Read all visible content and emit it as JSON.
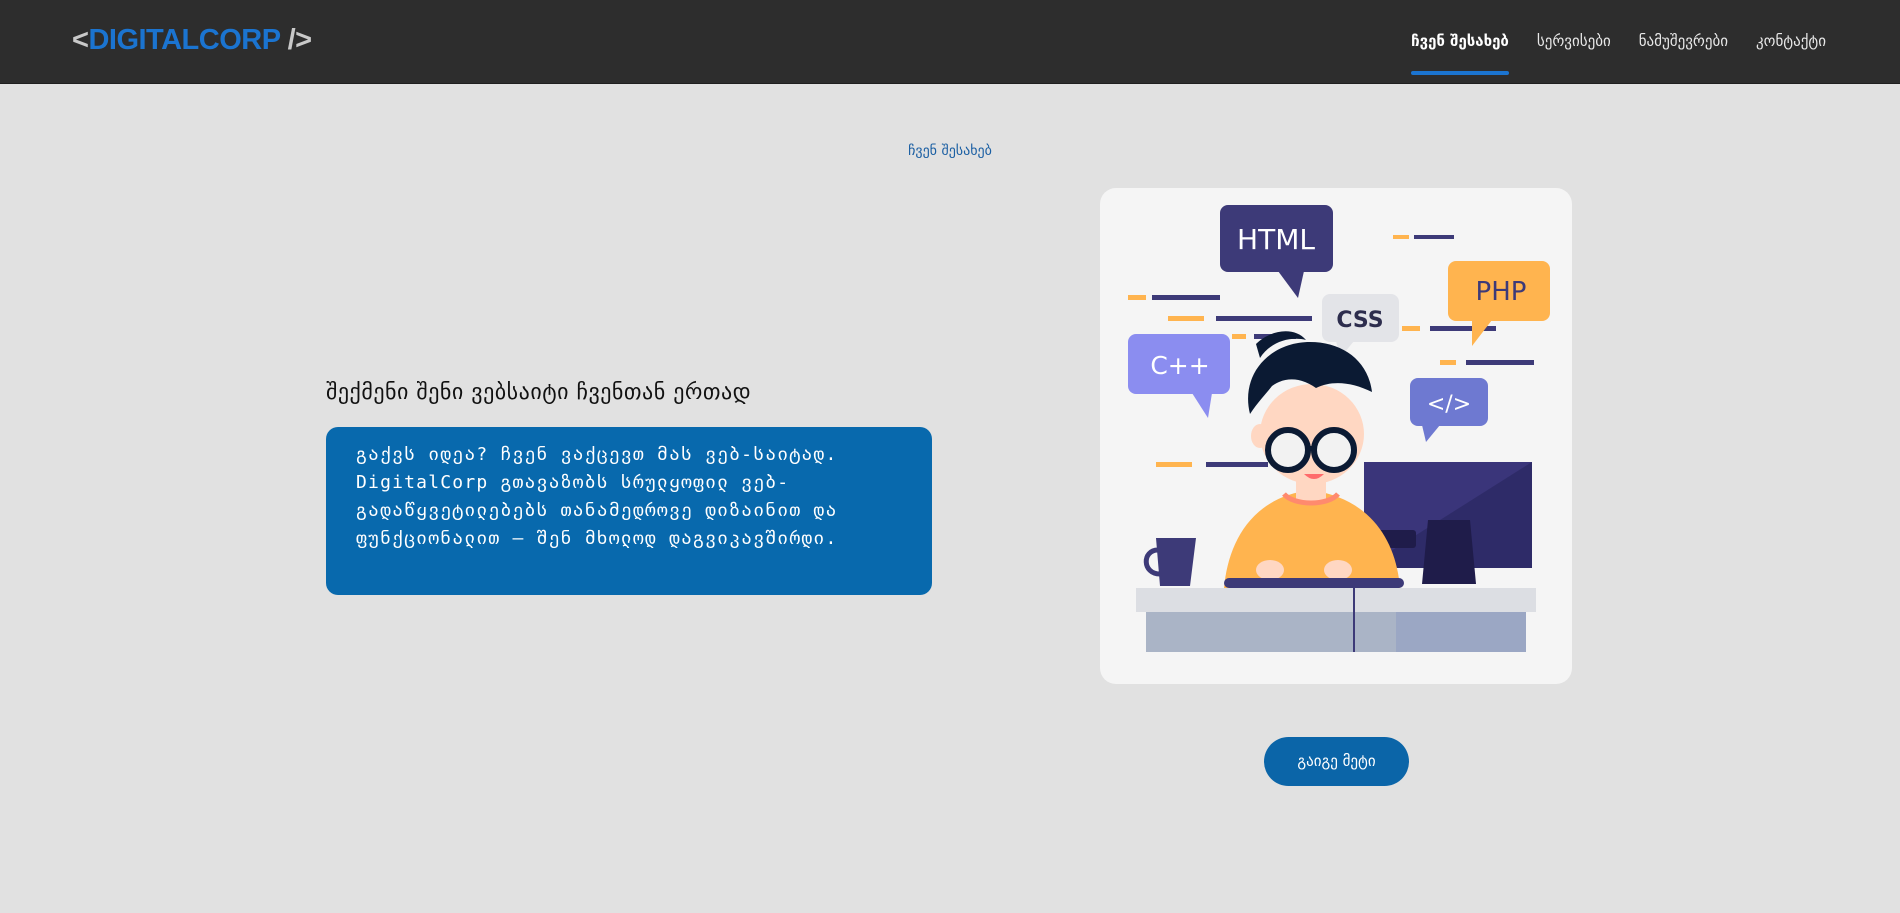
{
  "header": {
    "logo": {
      "open": "<",
      "brand": "DIGITALCORP",
      "close": " />"
    },
    "nav": [
      {
        "label": "ჩვენ შესახებ",
        "active": true
      },
      {
        "label": "სერვისები",
        "active": false
      },
      {
        "label": "ნამუშევრები",
        "active": false
      },
      {
        "label": "კონტაქტი",
        "active": false
      }
    ]
  },
  "about": {
    "section_label": "ჩვენ შესახებ",
    "headline": "შექმენი შენი ვებსაიტი ჩვენთან ერთად",
    "description": "გაქვს იდეა? ჩვენ ვაქცევთ მას ვებ-საიტად. DigitalCorp გთავაზობს სრულყოფილ ვებ-გადაწყვეტილებებს თანამედროვე დიზაინით და ფუნქციონალით — შენ მხოლოდ დაგვიკავშირდი.",
    "cta_label": "გაიგე მეტი"
  },
  "illustration": {
    "bubbles": [
      "HTML",
      "CSS",
      "PHP",
      "C++",
      "</>"
    ],
    "colors": {
      "navy": "#3d3a78",
      "orange": "#ffb44f",
      "purple": "#8b8df0",
      "blue_violet": "#6e79d1",
      "gray_bubble": "#e3e4e8",
      "accent": "#0869ad"
    }
  }
}
